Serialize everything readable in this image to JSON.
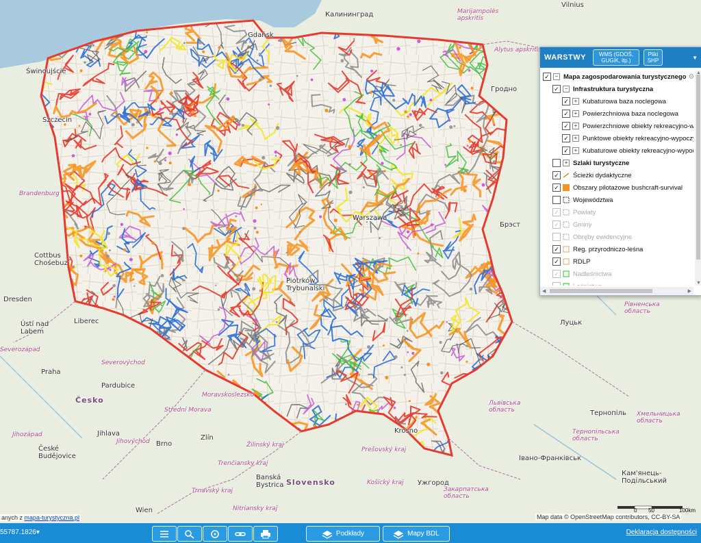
{
  "map": {
    "labels": {
      "vilnius": "Vilnius",
      "kaliningrad": "Калининград",
      "marijampole": "Marijampolės apskritis",
      "alytus": "Alytus apskritis",
      "grodno": "Гродно",
      "swinoujscie": "Świnoujście",
      "szczecin": "Szczecin",
      "brandenburg": "Brandenburg",
      "gdansk": "Gdańsk",
      "warszawa": "Warszawa",
      "brest": "Брэст",
      "cottbus": "Cottbus Chośebuz",
      "dresden": "Dresden",
      "liberec": "Liberec",
      "usti": "Ústí nad Labem",
      "severozapad": "Severozápad",
      "praha": "Praha",
      "pardubice": "Pardubice",
      "cesko": "Česko",
      "jihozapad": "Jihozápad",
      "ceske_budejovice": "České Budějovice",
      "jihovychod": "Jihovýchod",
      "jihlava": "Jihlava",
      "brno": "Brno",
      "zlin": "Zlín",
      "stredni_morava": "Střední Morava",
      "moravskoslezsko": "Moravskoslezsko",
      "severovychod": "Severovýchod",
      "zilinsky": "Žilinský kraj",
      "trenciansky": "Trenčiansky kraj",
      "banska": "Banská Bystrica",
      "slovensko": "Slovensko",
      "presovsky": "Prešovský kraj",
      "kosicky": "Košický kraj",
      "trnavsky": "Trnavský kraj",
      "nitriansky": "Nitriansky kraj",
      "wien": "Wien",
      "krosno": "Krosno",
      "piotrkow": "Piotrków Trybunalski",
      "lutsk": "Луцьк",
      "rivne_obl": "Рівненська область",
      "ternopil": "Тернопіль",
      "khmelnytskyi": "Хмельницька область",
      "ternopil_obl": "Тернопільська область",
      "ivano": "Івано-Франківськ",
      "kamianets": "Кам'янець-Подільський",
      "zakarpatska": "Закарпатська область",
      "uzhhorod": "Ужгород",
      "lvivska": "Львівська область"
    }
  },
  "layers_panel": {
    "title": "WARSTWY",
    "wms_button": "WMS (GDOŚ, GUGiK, itp.)",
    "shp_button": "Pliki SHP",
    "items": [
      {
        "label": "Mapa zagospodarowania turystycznego",
        "checked": "✓",
        "expander": "−"
      },
      {
        "label": "Infrastruktura turystyczna",
        "checked": "✓",
        "expander": "−"
      },
      {
        "label": "Kubaturowa baza noclegowa",
        "checked": "✓",
        "expander": "+"
      },
      {
        "label": "Powierzchniowa baza noclegowa",
        "checked": "✓",
        "expander": "+"
      },
      {
        "label": "Powierzchniowe obiekty rekreacyjno-wypoczynkowe",
        "checked": "✓",
        "expander": "+"
      },
      {
        "label": "Punktowe obiekty rekreacyjno-wypoczynkowe",
        "checked": "✓",
        "expander": "+"
      },
      {
        "label": "Kubaturowe obiekty rekreacyjno-wypoczynkowe",
        "checked": "✓",
        "expander": "+"
      },
      {
        "label": "Szlaki turystyczne",
        "checked": "",
        "expander": "+"
      },
      {
        "label": "Ścieżki dydaktyczne",
        "checked": "✓"
      },
      {
        "label": "Obszary pilotażowe bushcraft-survival",
        "checked": "✓"
      },
      {
        "label": "Województwa",
        "checked": ""
      },
      {
        "label": "Powiaty",
        "checked": "✓"
      },
      {
        "label": "Gminy",
        "checked": "✓"
      },
      {
        "label": "Obręby ewidencyjne",
        "checked": ""
      },
      {
        "label": "Reg. przyrodniczo-leśna",
        "checked": "✓"
      },
      {
        "label": "RDLP",
        "checked": "✓"
      },
      {
        "label": "Nadleśnictwa",
        "checked": "✓"
      },
      {
        "label": "Leśnictwa",
        "checked": ""
      }
    ],
    "colors": {
      "header": "#1f7fc3",
      "bushcraft": "#f7931e",
      "nadlesnictwa": "#4cd64c"
    }
  },
  "status": {
    "coords": "55787.1826",
    "data_credit_prefix": "anych z ",
    "data_credit_link": "mapa-turystyczna.pl",
    "attribution": "Map data © OpenStreetMap contributors, CC-BY-SA",
    "scale_0": "0",
    "scale_50": "50",
    "scale_100": "100km"
  },
  "toolbar": {
    "podklady": "Podkłady",
    "mapy_bdl": "Mapy BDL",
    "accessibility": "Deklaracja dostępności"
  }
}
